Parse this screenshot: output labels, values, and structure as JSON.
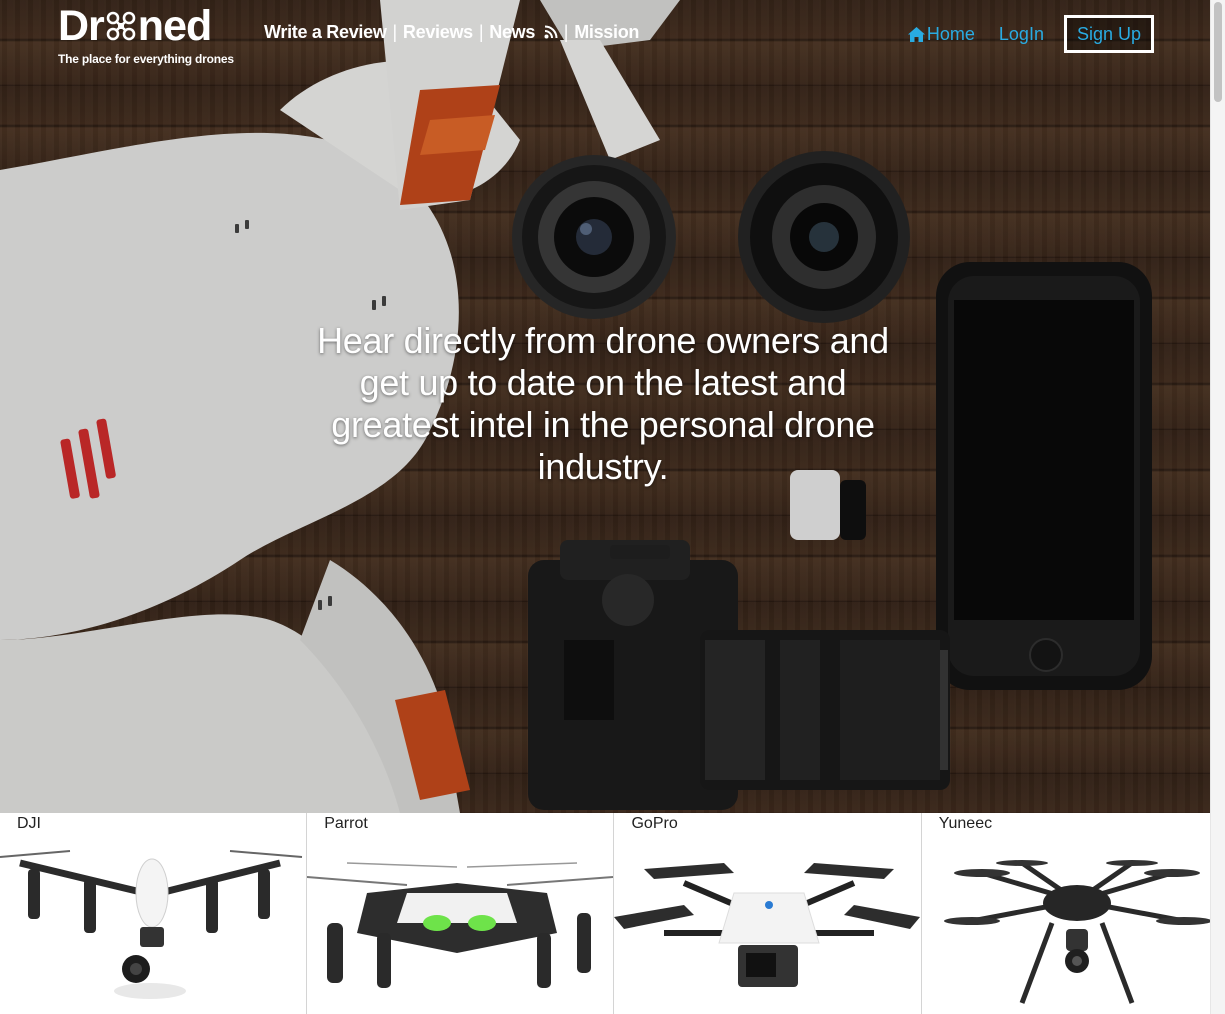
{
  "logo": {
    "prefix": "Dr",
    "suffix": "ned",
    "tagline": "The place for everything drones"
  },
  "nav": {
    "write_review": "Write a Review",
    "reviews": "Reviews",
    "news": "News",
    "mission": "Mission",
    "separator": "|",
    "home": "Home",
    "login": "LogIn",
    "signup": "Sign Up"
  },
  "hero": {
    "headline": "Hear directly from drone owners and get up to date on the latest and greatest intel in the personal drone industry."
  },
  "brands": [
    {
      "name": "DJI"
    },
    {
      "name": "Parrot"
    },
    {
      "name": "GoPro"
    },
    {
      "name": "Yuneec"
    }
  ],
  "colors": {
    "link_blue": "#29abe2",
    "wood": "#3b2819",
    "white": "#ffffff"
  }
}
